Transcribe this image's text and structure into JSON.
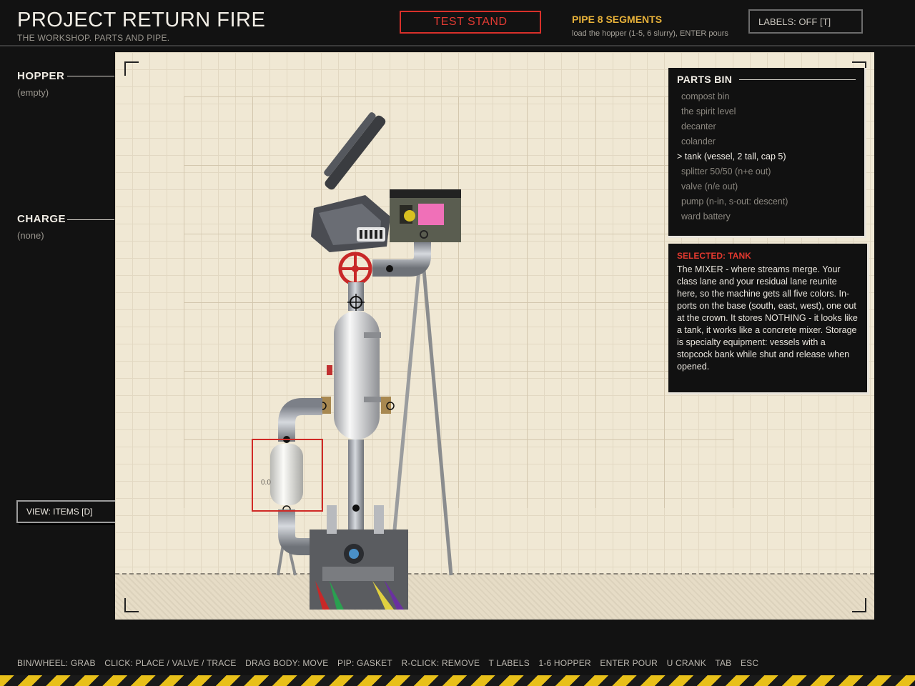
{
  "header": {
    "title": "PROJECT RETURN FIRE",
    "subtitle": "THE WORKSHOP. PARTS AND PIPE.",
    "test_stand_label": "TEST STAND",
    "pipe_title": "PIPE 8 SEGMENTS",
    "pipe_hint": "load the hopper (1-5, 6 slurry), ENTER pours",
    "labels_toggle": "LABELS: OFF  [T]"
  },
  "sidebar": {
    "hopper_label": "HOPPER",
    "hopper_value": "(empty)",
    "charge_label": "CHARGE",
    "charge_value": "(none)",
    "view_toggle": "VIEW: ITEMS  [D]"
  },
  "stage": {
    "selected_part_readout": "0.0"
  },
  "parts_bin": {
    "title": "PARTS BIN",
    "items": [
      {
        "label": "compost bin",
        "selected": false
      },
      {
        "label": "the spirit level",
        "selected": false
      },
      {
        "label": "decanter",
        "selected": false
      },
      {
        "label": "colander",
        "selected": false
      },
      {
        "label": "> tank (vessel, 2 tall, cap 5)",
        "selected": true
      },
      {
        "label": "splitter 50/50 (n+e out)",
        "selected": false
      },
      {
        "label": "valve (n/e out)",
        "selected": false
      },
      {
        "label": "pump (n-in, s-out: descent)",
        "selected": false
      },
      {
        "label": "ward battery",
        "selected": false
      }
    ]
  },
  "info": {
    "heading": "SELECTED: TANK",
    "body": "The MIXER - where streams merge. Your class lane and your residual lane reunite here, so the machine gets all five colors. In-ports on the base (south, east, west), one out at the crown. It stores NOTHING - it looks like a tank, it works like a concrete mixer. Storage is specialty equipment: vessels with a stopcock bank while shut and release when opened."
  },
  "footer": {
    "hints": [
      "BIN/WHEEL: GRAB",
      "CLICK: PLACE / VALVE / TRACE",
      "DRAG BODY: MOVE",
      "PIP: GASKET",
      "R-CLICK: REMOVE",
      "T LABELS",
      "1-6 HOPPER",
      "ENTER POUR",
      "U CRANK",
      "TAB",
      "ESC"
    ]
  },
  "colors": {
    "accent_red": "#d8302a",
    "accent_yellow": "#e8b23a",
    "stage_bg": "#f0e8d4"
  }
}
